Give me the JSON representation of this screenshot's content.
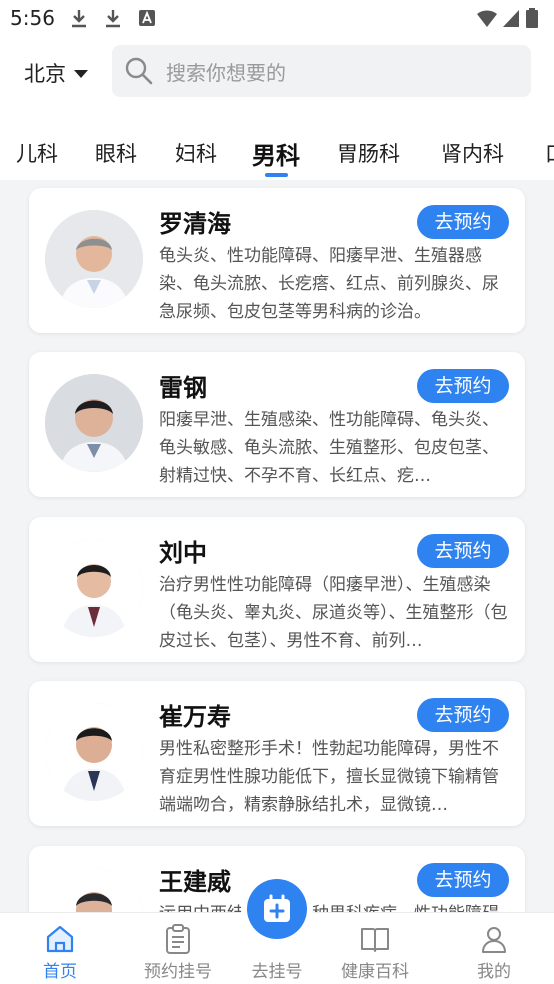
{
  "status": {
    "time": "5:56"
  },
  "header": {
    "city": "北京",
    "search_placeholder": "搜索你想要的"
  },
  "tabs": [
    "儿科",
    "眼科",
    "妇科",
    "男科",
    "胃肠科",
    "肾内科",
    "口"
  ],
  "active_tab": "男科",
  "doctors": [
    {
      "name": "罗清海",
      "book": "去预约",
      "desc": "龟头炎、性功能障碍、阳痿早泄、生殖器感染、龟头流脓、长疙瘩、红点、前列腺炎、尿急尿频、包皮包茎等男科病的诊治。"
    },
    {
      "name": "雷钢",
      "book": "去预约",
      "desc": "阳痿早泄、生殖感染、性功能障碍、龟头炎、龟头敏感、龟头流脓、生殖整形、包皮包茎、射精过快、不孕不育、长红点、疙…"
    },
    {
      "name": "刘中",
      "book": "去预约",
      "desc": "治疗男性性功能障碍（阳痿早泄）、生殖感染（龟头炎、睾丸炎、尿道炎等）、生殖整形（包皮过长、包茎）、男性不育、前列…"
    },
    {
      "name": "崔万寿",
      "book": "去预约",
      "desc": "男性私密整形手术！性勃起功能障碍，男性不育症男性性腺功能低下，擅长显微镜下输精管端端吻合，精索静脉结扎术，显微镜…"
    },
    {
      "name": "王建威",
      "book": "去预约",
      "desc": "运用中西结合治疗各种男科疾病，性功能障碍"
    }
  ],
  "nav": [
    {
      "label": "首页"
    },
    {
      "label": "预约挂号"
    },
    {
      "label": "去挂号"
    },
    {
      "label": "健康百科"
    },
    {
      "label": "我的"
    }
  ],
  "colors": {
    "accent": "#2f83f0",
    "background": "#f3f4f6"
  }
}
